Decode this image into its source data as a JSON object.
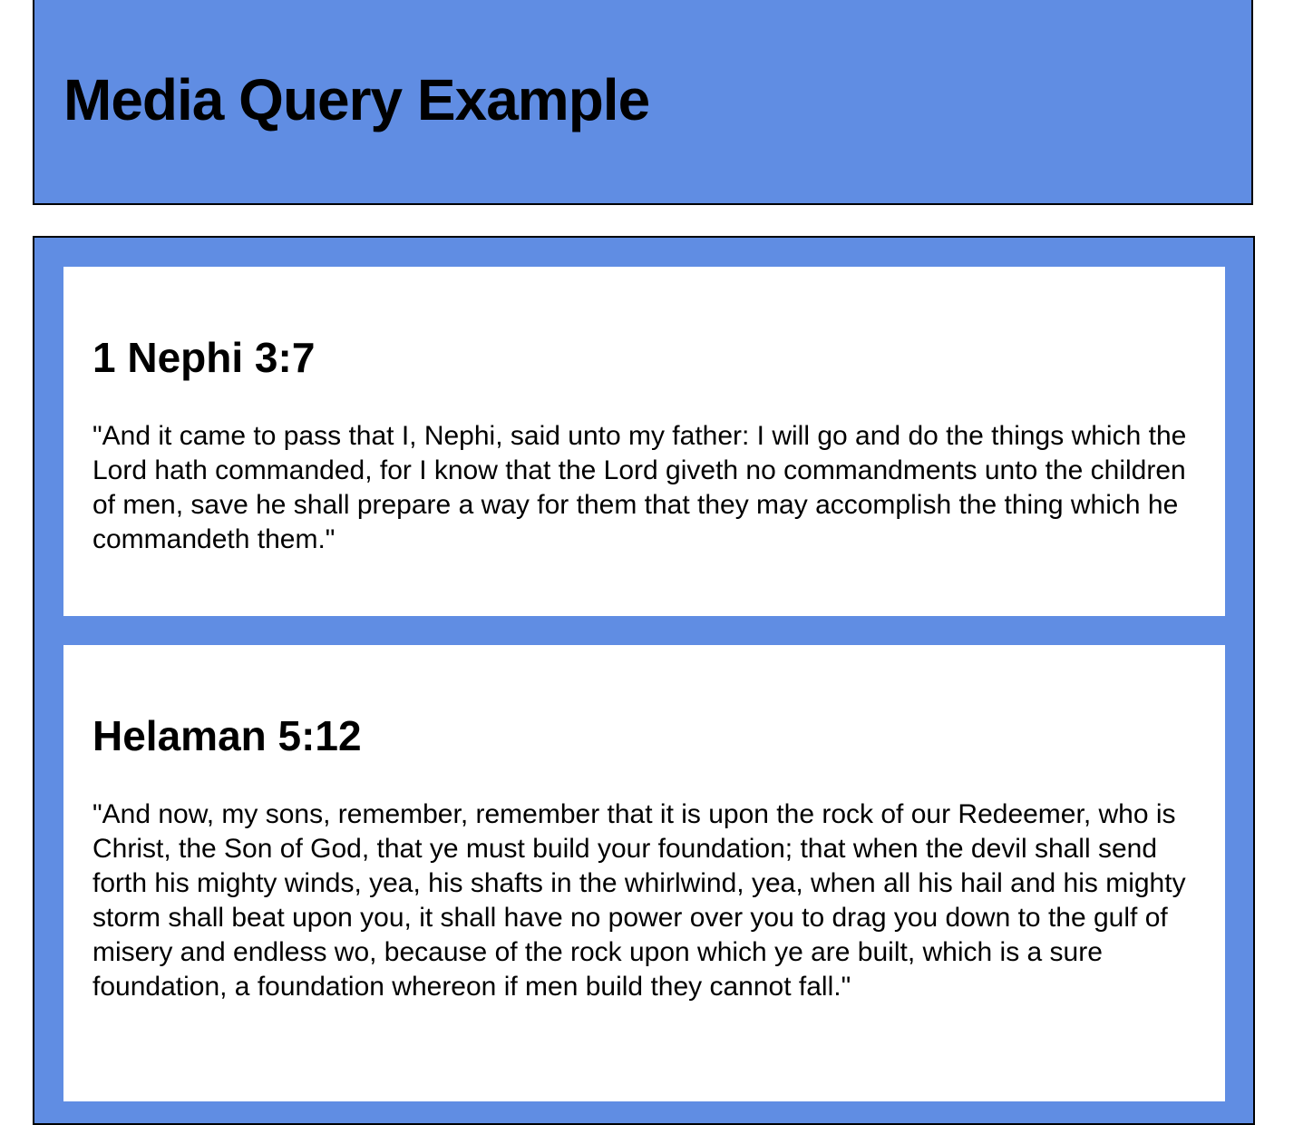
{
  "header": {
    "title": "Media Query Example"
  },
  "cards": [
    {
      "heading": "1 Nephi 3:7",
      "text": "\"And it came to pass that I, Nephi, said unto my father: I will go and do the things which the Lord hath commanded, for I know that the Lord giveth no commandments unto the children of men, save he shall prepare a way for them that they may accomplish the thing which he commandeth them.\""
    },
    {
      "heading": "Helaman 5:12",
      "text": "\"And now, my sons, remember, remember that it is upon the rock of our Redeemer, who is Christ, the Son of God, that ye must build your foundation; that when the devil shall send forth his mighty winds, yea, his shafts in the whirlwind, yea, when all his hail and his mighty storm shall beat upon you, it shall have no power over you to drag you down to the gulf of misery and endless wo, because of the rock upon which ye are built, which is a sure foundation, a foundation whereon if men build they cannot fall.\""
    }
  ],
  "colors": {
    "accent": "#608de3",
    "card_background": "#ffffff",
    "border": "#000000"
  }
}
